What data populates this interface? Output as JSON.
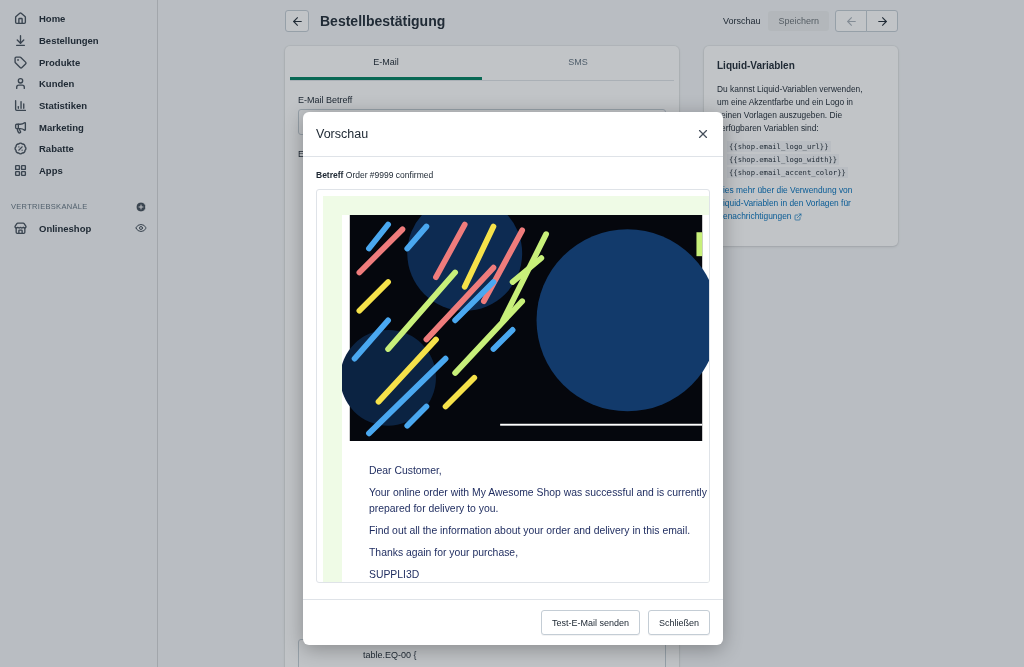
{
  "sidebar": {
    "items": [
      {
        "label": "Home"
      },
      {
        "label": "Bestellungen"
      },
      {
        "label": "Produkte"
      },
      {
        "label": "Kunden"
      },
      {
        "label": "Statistiken"
      },
      {
        "label": "Marketing"
      },
      {
        "label": "Rabatte"
      },
      {
        "label": "Apps"
      }
    ],
    "channels_heading": "VERTRIEBSKANÄLE",
    "channels": [
      {
        "label": "Onlineshop"
      }
    ]
  },
  "header": {
    "title": "Bestellbestätigung",
    "preview_button": "Vorschau",
    "save_button": {
      "label": "Speichern",
      "disabled": true
    },
    "prev_disabled": true,
    "next_disabled": false
  },
  "editor": {
    "tabs": [
      {
        "label": "E-Mail",
        "selected": true
      },
      {
        "label": "SMS",
        "selected": false
      }
    ],
    "subject_label": "E-Mail Betreff",
    "body_label": "E",
    "code_line": "table.EQ-00 {"
  },
  "liquid_card": {
    "title": "Liquid-Variablen",
    "lines": [
      "Du kannst Liquid-Variablen verwenden,",
      "um eine Akzentfarbe und ein Logo in",
      "einen Vorlagen auszugeben. Die",
      "erfügbaren Variablen sind:"
    ],
    "variables": [
      "{{shop.email_logo_url}}",
      "{{shop.email_logo_width}}",
      "{{shop.email_accent_color}}"
    ],
    "link_lines": [
      "ies mehr über die Verwendung von",
      "iquid-Variablen in den Vorlagen für",
      "enachrichtigungen"
    ]
  },
  "modal": {
    "title": "Vorschau",
    "subject_label": "Betreff",
    "subject": "Order #9999 confirmed",
    "email_paragraphs": [
      "Dear Customer,",
      "Your online order with My Awesome Shop was successful and is currently prepared for delivery to you.",
      "Find out all the information about your order and delivery in this email.",
      "Thanks again for your purchase,",
      "SUPPLI3D"
    ],
    "buttons": [
      "Test-E-Mail senden",
      "Schließen"
    ]
  }
}
